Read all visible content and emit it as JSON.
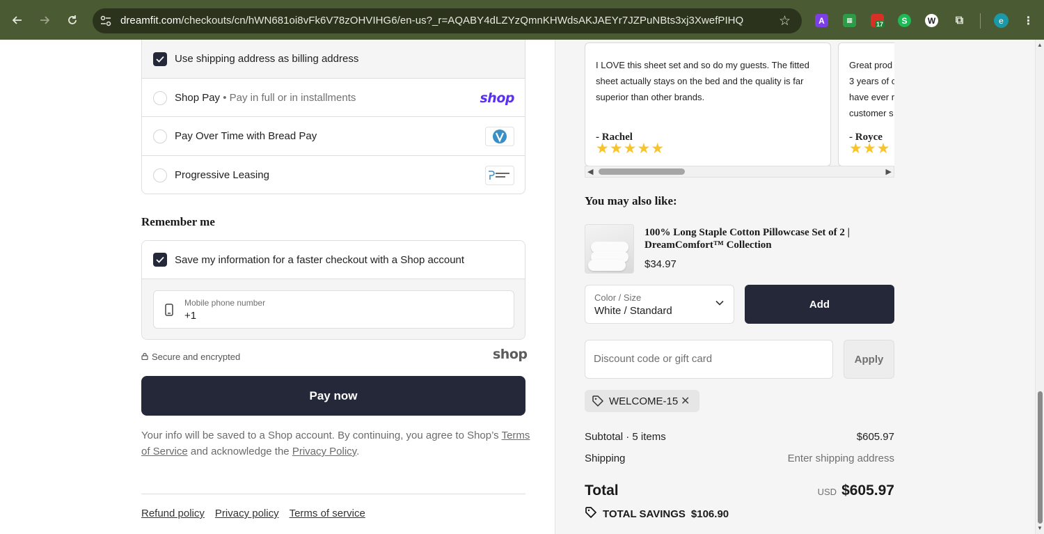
{
  "browser": {
    "url_domain": "dreamfit.com",
    "url_path": "/checkouts/cn/hWN681oi8vFk6V78zOHVIHG6/en-us?_r=AQABY4dLZYzQmnKHWdsAKJAEYr7JZPuNBts3xj3XwefPIHQ",
    "extension_badge": "17",
    "profile_initial": "e"
  },
  "payment": {
    "billing_same_label": "Use shipping address as billing address",
    "options": [
      {
        "label": "Shop Pay",
        "sub": "• Pay in full or in installments",
        "logo": "shop"
      },
      {
        "label": "Pay Over Time with Bread Pay",
        "sub": "",
        "logo": "bread-pay"
      },
      {
        "label": "Progressive Leasing",
        "sub": "",
        "logo": "progressive-leasing"
      }
    ]
  },
  "remember": {
    "title": "Remember me",
    "save_label": "Save my information for a faster checkout with a Shop account",
    "phone_label": "Mobile phone number",
    "phone_value": "+1"
  },
  "secure_text": "Secure and encrypted",
  "shop_wordmark": "shop",
  "pay_now_label": "Pay now",
  "consent": {
    "pre": "Your info will be saved to a Shop account. By continuing, you agree to Shop’s ",
    "tos": "Terms of Service",
    "mid": " and acknowledge the ",
    "privacy": "Privacy Policy",
    "post": "."
  },
  "footer_links": [
    "Refund policy",
    "Privacy policy",
    "Terms of service"
  ],
  "reviews": [
    {
      "text": "I LOVE this sheet set and so do my guests. The fitted sheet actually stays on the bed and the quality is far superior than other brands.",
      "author": "- Rachel",
      "stars": "★★★★★"
    },
    {
      "text": "Great prod 3 years of c have ever r customer s",
      "author": "- Royce",
      "stars": "★★★"
    }
  ],
  "upsell": {
    "heading": "You may also like:",
    "product_name": "100% Long Staple Cotton Pillowcase Set of 2 | DreamComfort™ Collection",
    "price": "$34.97",
    "select_label": "Color / Size",
    "select_value": "White / Standard",
    "add_label": "Add"
  },
  "discount": {
    "placeholder": "Discount code or gift card",
    "apply_label": "Apply",
    "applied_code": "WELCOME-15"
  },
  "summary": {
    "subtotal_label": "Subtotal · 5 items",
    "subtotal_value": "$605.97",
    "shipping_label": "Shipping",
    "shipping_value": "Enter shipping address",
    "total_label": "Total",
    "currency": "USD",
    "total_value": "$605.97",
    "savings_label": "TOTAL SAVINGS",
    "savings_value": "$106.90"
  },
  "colors": {
    "primary_button": "#252838",
    "shop_purple": "#5a31f4",
    "star": "#f7c52b",
    "chrome": "#4a5a33"
  }
}
